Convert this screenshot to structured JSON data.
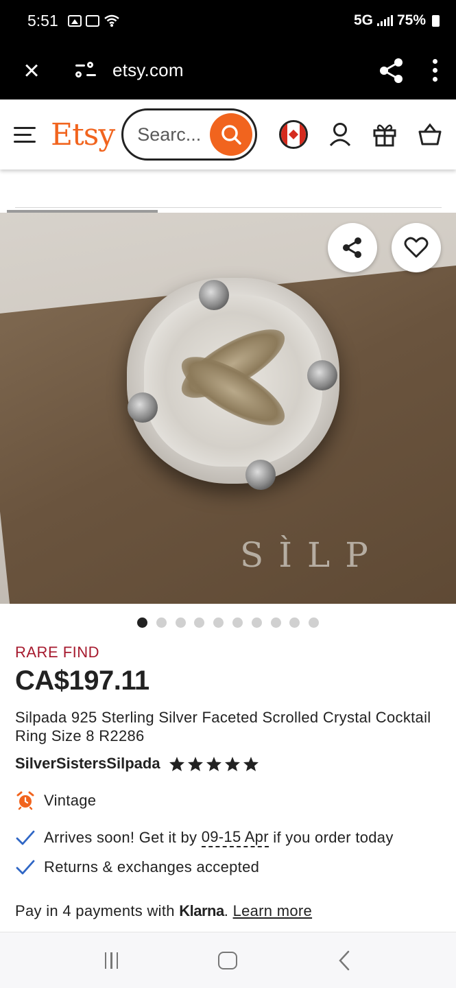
{
  "status_bar": {
    "time": "5:51",
    "network": "5G",
    "battery": "75%"
  },
  "browser": {
    "url": "etsy.com"
  },
  "header": {
    "logo": "Etsy",
    "search_placeholder": "Search for anything",
    "search_visible_text": "Searc...",
    "accent_color": "#F1641E"
  },
  "product": {
    "image_watermark": "SÌLP",
    "image_count": 10,
    "active_image_index": 0,
    "badge": "RARE FIND",
    "price": "CA$197.11",
    "title": "Silpada 925 Sterling Silver Faceted Scrolled Crystal Cocktail Ring Size 8 R2286",
    "shop_name": "SilverSistersSilpada",
    "rating_stars": 5,
    "features": {
      "vintage": "Vintage",
      "arrives_prefix": "Arrives soon! Get it by ",
      "arrives_dates": "09-15 Apr",
      "arrives_suffix": " if you order today",
      "returns": "Returns & exchanges accepted"
    },
    "payments": {
      "prefix": "Pay in 4 payments with ",
      "provider": "Klarna",
      "separator": ".",
      "learn_more": "Learn more"
    }
  },
  "colors": {
    "rare_find": "#A61A2E",
    "check": "#2F66C5",
    "vintage_icon": "#F1641E"
  }
}
